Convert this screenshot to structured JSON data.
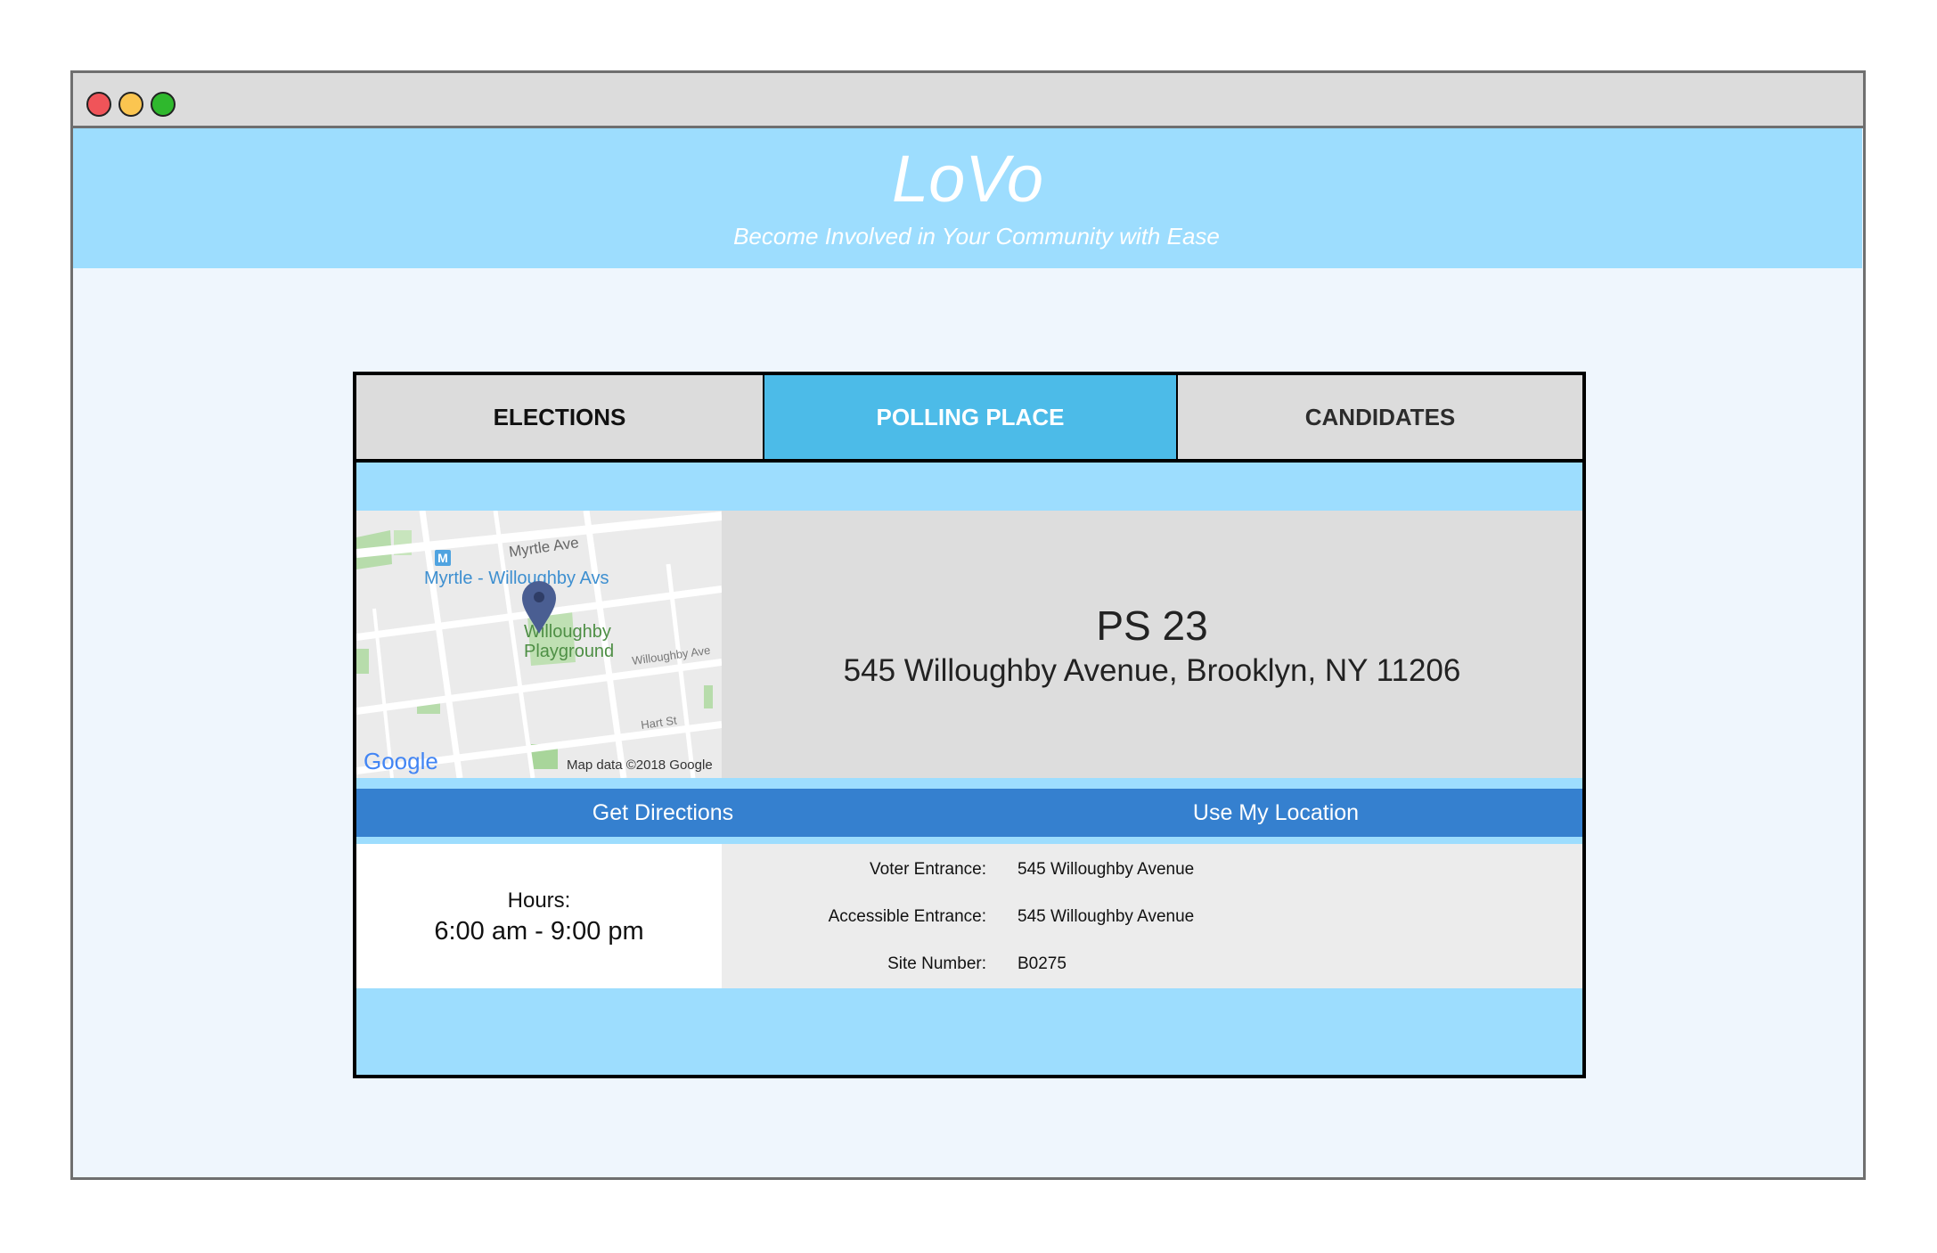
{
  "header": {
    "brand": "LoVo",
    "tagline": "Become Involved in Your Community with Ease"
  },
  "tabs": [
    {
      "label": "ELECTIONS",
      "active": false
    },
    {
      "label": "POLLING PLACE",
      "active": true
    },
    {
      "label": "CANDIDATES",
      "active": false
    }
  ],
  "map": {
    "streets": [
      "Myrtle Ave",
      "Willoughby Ave",
      "Hart St"
    ],
    "station": "Myrtle - Willoughby Avs",
    "station_icon": "M",
    "park_line1": "Willoughby",
    "park_line2": "Playground",
    "logo": "Google",
    "attribution": "Map data ©2018 Google"
  },
  "polling_place": {
    "name": "PS 23",
    "address": "545 Willoughby Avenue, Brooklyn, NY 11206"
  },
  "actions": {
    "directions": "Get Directions",
    "location": "Use My Location"
  },
  "hours": {
    "label": "Hours:",
    "value": "6:00 am - 9:00 pm"
  },
  "details": [
    {
      "label": "Voter Entrance:",
      "value": "545 Willoughby Avenue"
    },
    {
      "label": "Accessible Entrance:",
      "value": "545 Willoughby Avenue"
    },
    {
      "label": "Site Number:",
      "value": "B0275"
    }
  ],
  "colors": {
    "hero": "#9dddfe",
    "active_tab": "#4cbbe8",
    "action_bar": "#3580cf",
    "page_bg": "#eff6fd"
  }
}
